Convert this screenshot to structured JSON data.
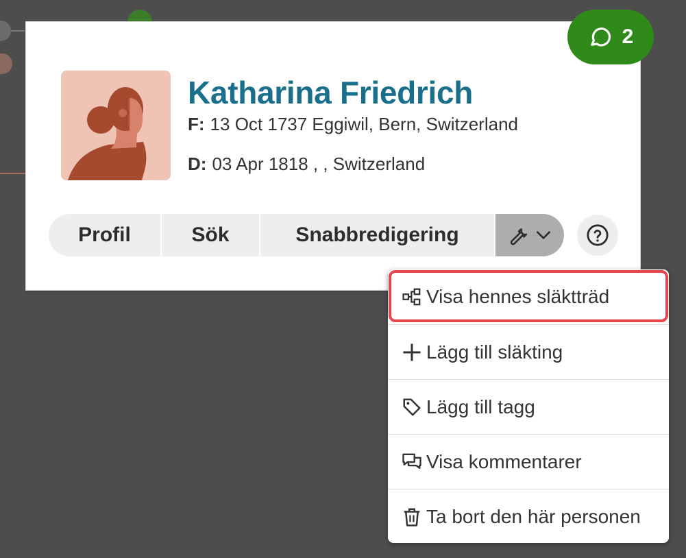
{
  "person": {
    "name": "Katharina Friedrich",
    "birth": {
      "key": "F:",
      "value": "13 Oct 1737 Eggiwil, Bern, Switzerland"
    },
    "death": {
      "key": "D:",
      "value": "03 Apr 1818 , , Switzerland"
    },
    "avatar_icon": "female-silhouette-icon"
  },
  "comments_badge": {
    "count": "2",
    "icon": "comment-bubble-icon",
    "color": "#2f8a19"
  },
  "actions": {
    "profile": "Profil",
    "search": "Sök",
    "quick_edit": "Snabbredigering",
    "tools_icon": "wrench-icon",
    "tools_chevron": "chevron-down-icon",
    "help_icon": "question-circle-icon"
  },
  "menu": {
    "items": [
      {
        "label": "Visa hennes släktträd",
        "icon": "family-tree-icon",
        "highlighted": true
      },
      {
        "label": "Lägg till släkting",
        "icon": "plus-icon"
      },
      {
        "label": "Lägg till tagg",
        "icon": "tag-icon"
      },
      {
        "label": "Visa kommentarer",
        "icon": "comments-icon"
      },
      {
        "label": "Ta bort den här personen",
        "icon": "trash-icon"
      }
    ]
  },
  "colors": {
    "name": "#1a6f8c",
    "highlight": "#e8454c",
    "background": "#4d4d4d",
    "tools_button": "#adadad"
  }
}
